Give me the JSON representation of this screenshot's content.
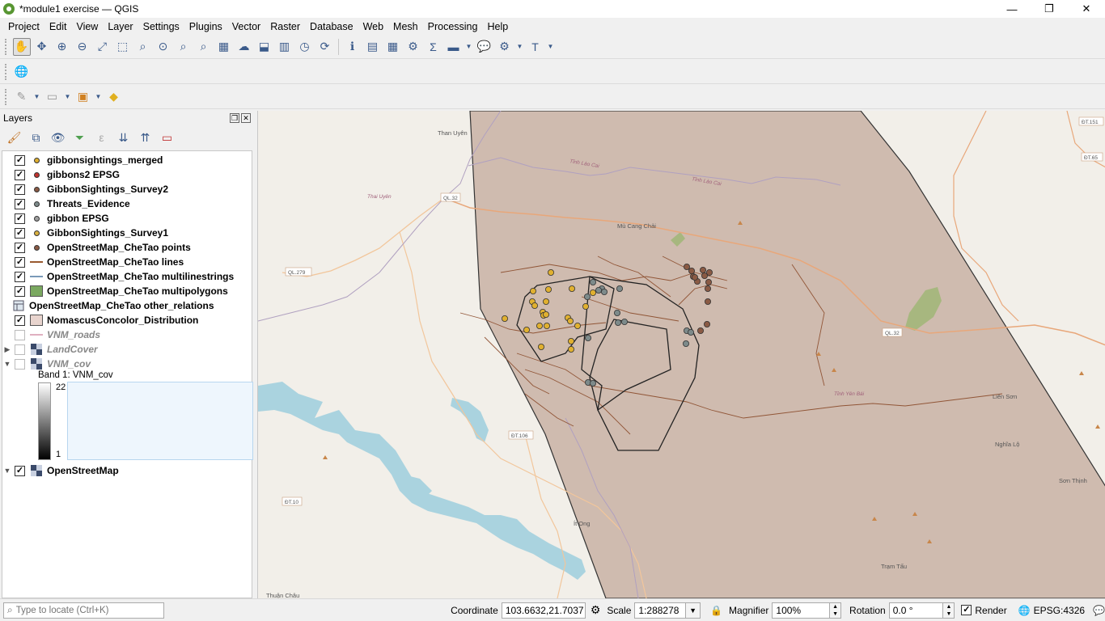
{
  "window": {
    "title": "*module1 exercise — QGIS",
    "minimize": "—",
    "maximize": "❐",
    "close": "✕"
  },
  "menu": [
    "Project",
    "Edit",
    "View",
    "Layer",
    "Settings",
    "Plugins",
    "Vector",
    "Raster",
    "Database",
    "Web",
    "Mesh",
    "Processing",
    "Help"
  ],
  "layers_panel": {
    "title": "Layers",
    "layers": [
      {
        "name": "gibbonsightings_merged",
        "checked": true,
        "color": "#e0b030",
        "kind": "point"
      },
      {
        "name": "gibbons2 EPSG",
        "checked": true,
        "color": "#c0332e",
        "kind": "point"
      },
      {
        "name": "GibbonSightings_Survey2",
        "checked": true,
        "color": "#8a5a44",
        "kind": "point"
      },
      {
        "name": "Threats_Evidence",
        "checked": true,
        "color": "#7d8a8a",
        "kind": "point"
      },
      {
        "name": "gibbon EPSG",
        "checked": true,
        "color": "#a0a0a0",
        "kind": "point"
      },
      {
        "name": "GibbonSightings_Survey1",
        "checked": true,
        "color": "#d9b040",
        "kind": "point"
      },
      {
        "name": "OpenStreetMap_CheTao points",
        "checked": true,
        "color": "#8a5a44",
        "kind": "point"
      },
      {
        "name": "OpenStreetMap_CheTao lines",
        "checked": true,
        "color": "#9a5a30",
        "kind": "line"
      },
      {
        "name": "OpenStreetMap_CheTao multilinestrings",
        "checked": true,
        "color": "#7a9ab8",
        "kind": "line"
      },
      {
        "name": "OpenStreetMap_CheTao multipolygons",
        "checked": true,
        "color": "#7aa860",
        "kind": "polygon"
      },
      {
        "name": "OpenStreetMap_CheTao other_relations",
        "checked": null,
        "color": "",
        "kind": "table"
      },
      {
        "name": "NomascusConcolor_Distribution",
        "checked": true,
        "color": "#e8d4ce",
        "kind": "polygon"
      },
      {
        "name": "VNM_roads",
        "checked": false,
        "color": "#e0b0c0",
        "kind": "line"
      },
      {
        "name": "LandCover",
        "checked": false,
        "color": "",
        "kind": "raster"
      },
      {
        "name": "VNM_cov",
        "checked": false,
        "color": "",
        "kind": "raster"
      }
    ],
    "band_label": "Band 1: VNM_cov",
    "ramp_max": "22",
    "ramp_min": "1",
    "basemap": {
      "name": "OpenStreetMap",
      "checked": true
    }
  },
  "map_labels": {
    "than_uyen": "Than Uyên",
    "mu_cang_chai": "Mù Cang Chải",
    "it_ong": "Ít Ong",
    "lien_son": "Liên Sơn",
    "nghia_lo": "Nghĩa Lộ",
    "son_thinh": "Sơn Thịnh",
    "tram_tau": "Trạm Tấu",
    "thuan_chau": "Thuận Châu",
    "ql32_a": "QL.32",
    "ql32_b": "QL.32",
    "ql279": "QL.279",
    "dt106": "ĐT.106",
    "dt10": "ĐT.10",
    "dt151": "ĐT.151",
    "dt165": "ĐT.65",
    "tinh_lao_cai": "Tỉnh Lào Cai",
    "tinh_lao_cai_2": "Tỉnh Lào Cai",
    "tinh_yen_bai": "Tỉnh Yên Bái",
    "thai_uyen": "Thai Uyên"
  },
  "status": {
    "locate_placeholder": "Type to locate (Ctrl+K)",
    "coordinate_label": "Coordinate",
    "coordinate": "103.6632,21.7037",
    "scale_label": "Scale",
    "scale": "1:288278",
    "magnifier_label": "Magnifier",
    "magnifier": "100%",
    "rotation_label": "Rotation",
    "rotation": "0.0 °",
    "render_label": "Render",
    "crs": "EPSG:4326"
  },
  "colors": {
    "range_fill": "#b39080",
    "survey1": "#e0b030",
    "threats": "#7d8a8a",
    "survey2": "#8a5a44",
    "water": "#aad3df",
    "forest": "#a7b77f"
  }
}
